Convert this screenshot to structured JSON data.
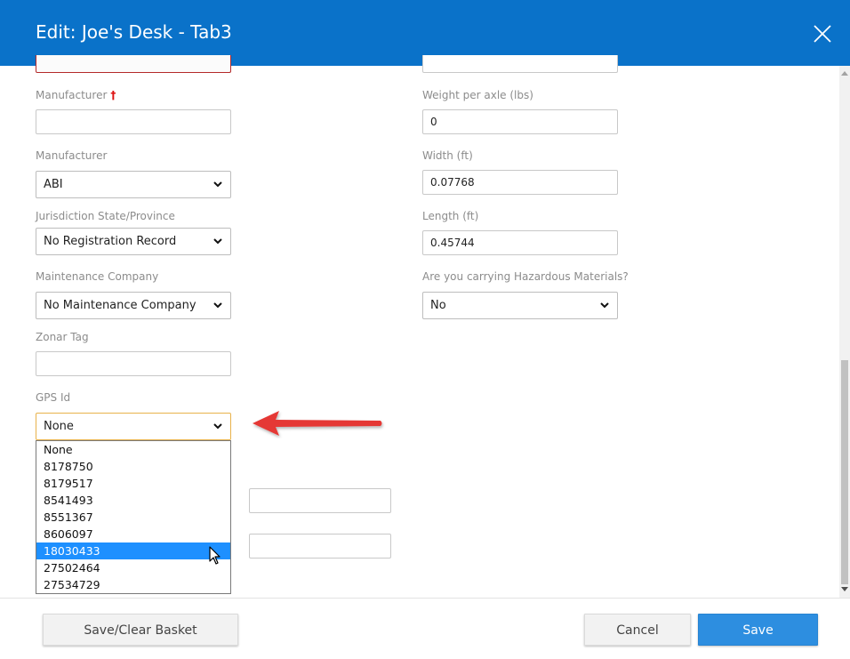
{
  "dialog": {
    "title": "Edit: Joe's Desk - Tab3"
  },
  "left_fields": {
    "manufacturer_required": {
      "label": "Manufacturer",
      "required_mark": "†",
      "value": ""
    },
    "manufacturer_select": {
      "label": "Manufacturer",
      "value": "ABI"
    },
    "jurisdiction": {
      "label": "Jurisdiction State/Province",
      "value": "No Registration Record"
    },
    "maintenance": {
      "label": "Maintenance Company",
      "value": "No Maintenance Company"
    },
    "zonar_tag": {
      "label": "Zonar Tag",
      "value": ""
    },
    "gps_id": {
      "label": "GPS Id",
      "value": "None"
    }
  },
  "right_fields": {
    "weight_per_axle": {
      "label": "Weight per axle (lbs)",
      "value": "0"
    },
    "width": {
      "label": "Width (ft)",
      "value": "0.07768"
    },
    "length": {
      "label": "Length (ft)",
      "value": "0.45744"
    },
    "hazardous": {
      "label": "Are you carrying Hazardous Materials?",
      "value": "No"
    }
  },
  "gps_dropdown": {
    "options": [
      "None",
      "8178750",
      "8179517",
      "8541493",
      "8551367",
      "8606097",
      "18030433",
      "27502464",
      "27534729"
    ],
    "highlighted": "18030433"
  },
  "footer": {
    "save_clear_label": "Save/Clear Basket",
    "cancel_label": "Cancel",
    "save_label": "Save"
  },
  "colors": {
    "header": "#0a72c9",
    "primary_button": "#2d8ee0",
    "highlight": "#1e90ff",
    "annotation_arrow": "#e53935"
  }
}
